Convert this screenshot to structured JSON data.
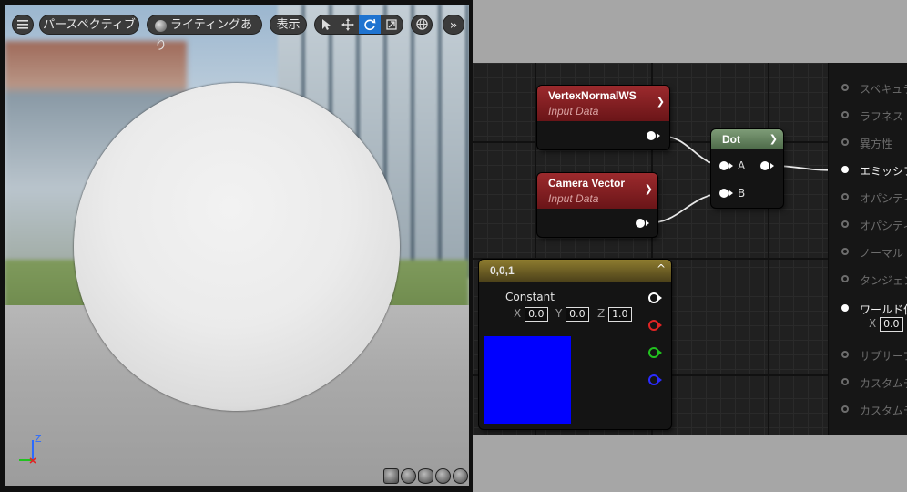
{
  "viewport": {
    "toolbar": {
      "perspective_label": "パースペクティブ",
      "lighting_label": "ライティングあり",
      "show_label": "表示"
    },
    "axis": {
      "z": "Z"
    }
  },
  "graph": {
    "nodes": {
      "vertex_normal": {
        "title": "VertexNormalWS",
        "subtitle": "Input Data"
      },
      "camera_vector": {
        "title": "Camera Vector",
        "subtitle": "Input Data"
      },
      "dot": {
        "title": "Dot",
        "pin_a": "A",
        "pin_b": "B"
      },
      "constant": {
        "title": "0,0,1",
        "label": "Constant",
        "x_label": "X",
        "x_value": "0.0",
        "y_label": "Y",
        "y_value": "0.0",
        "z_label": "Z",
        "z_value": "1.0",
        "swatch_color": "#0000ff"
      }
    }
  },
  "result_panel": {
    "pins": [
      {
        "label": "スペキュラ",
        "active": false
      },
      {
        "label": "ラフネス",
        "active": false
      },
      {
        "label": "異方性",
        "active": false
      },
      {
        "label": "エミッシブ",
        "active": true
      },
      {
        "label": "オパシティ",
        "active": false
      },
      {
        "label": "オパシティ",
        "active": false
      },
      {
        "label": "ノーマル",
        "active": false
      },
      {
        "label": "タンジェン",
        "active": false
      },
      {
        "label": "ワールド位",
        "active": true
      },
      {
        "label": "サブサーフ",
        "active": false
      },
      {
        "label": "カスタムデ",
        "active": false
      },
      {
        "label": "カスタムデ",
        "active": false
      }
    ],
    "world_x_label": "X",
    "world_x_value": "0.0"
  },
  "colors": {
    "input_node_header": "#8a1e22",
    "dot_node_header": "#5f7d5a",
    "constant_node_header": "#6f6228",
    "toolbar_active": "#1e73d0"
  }
}
